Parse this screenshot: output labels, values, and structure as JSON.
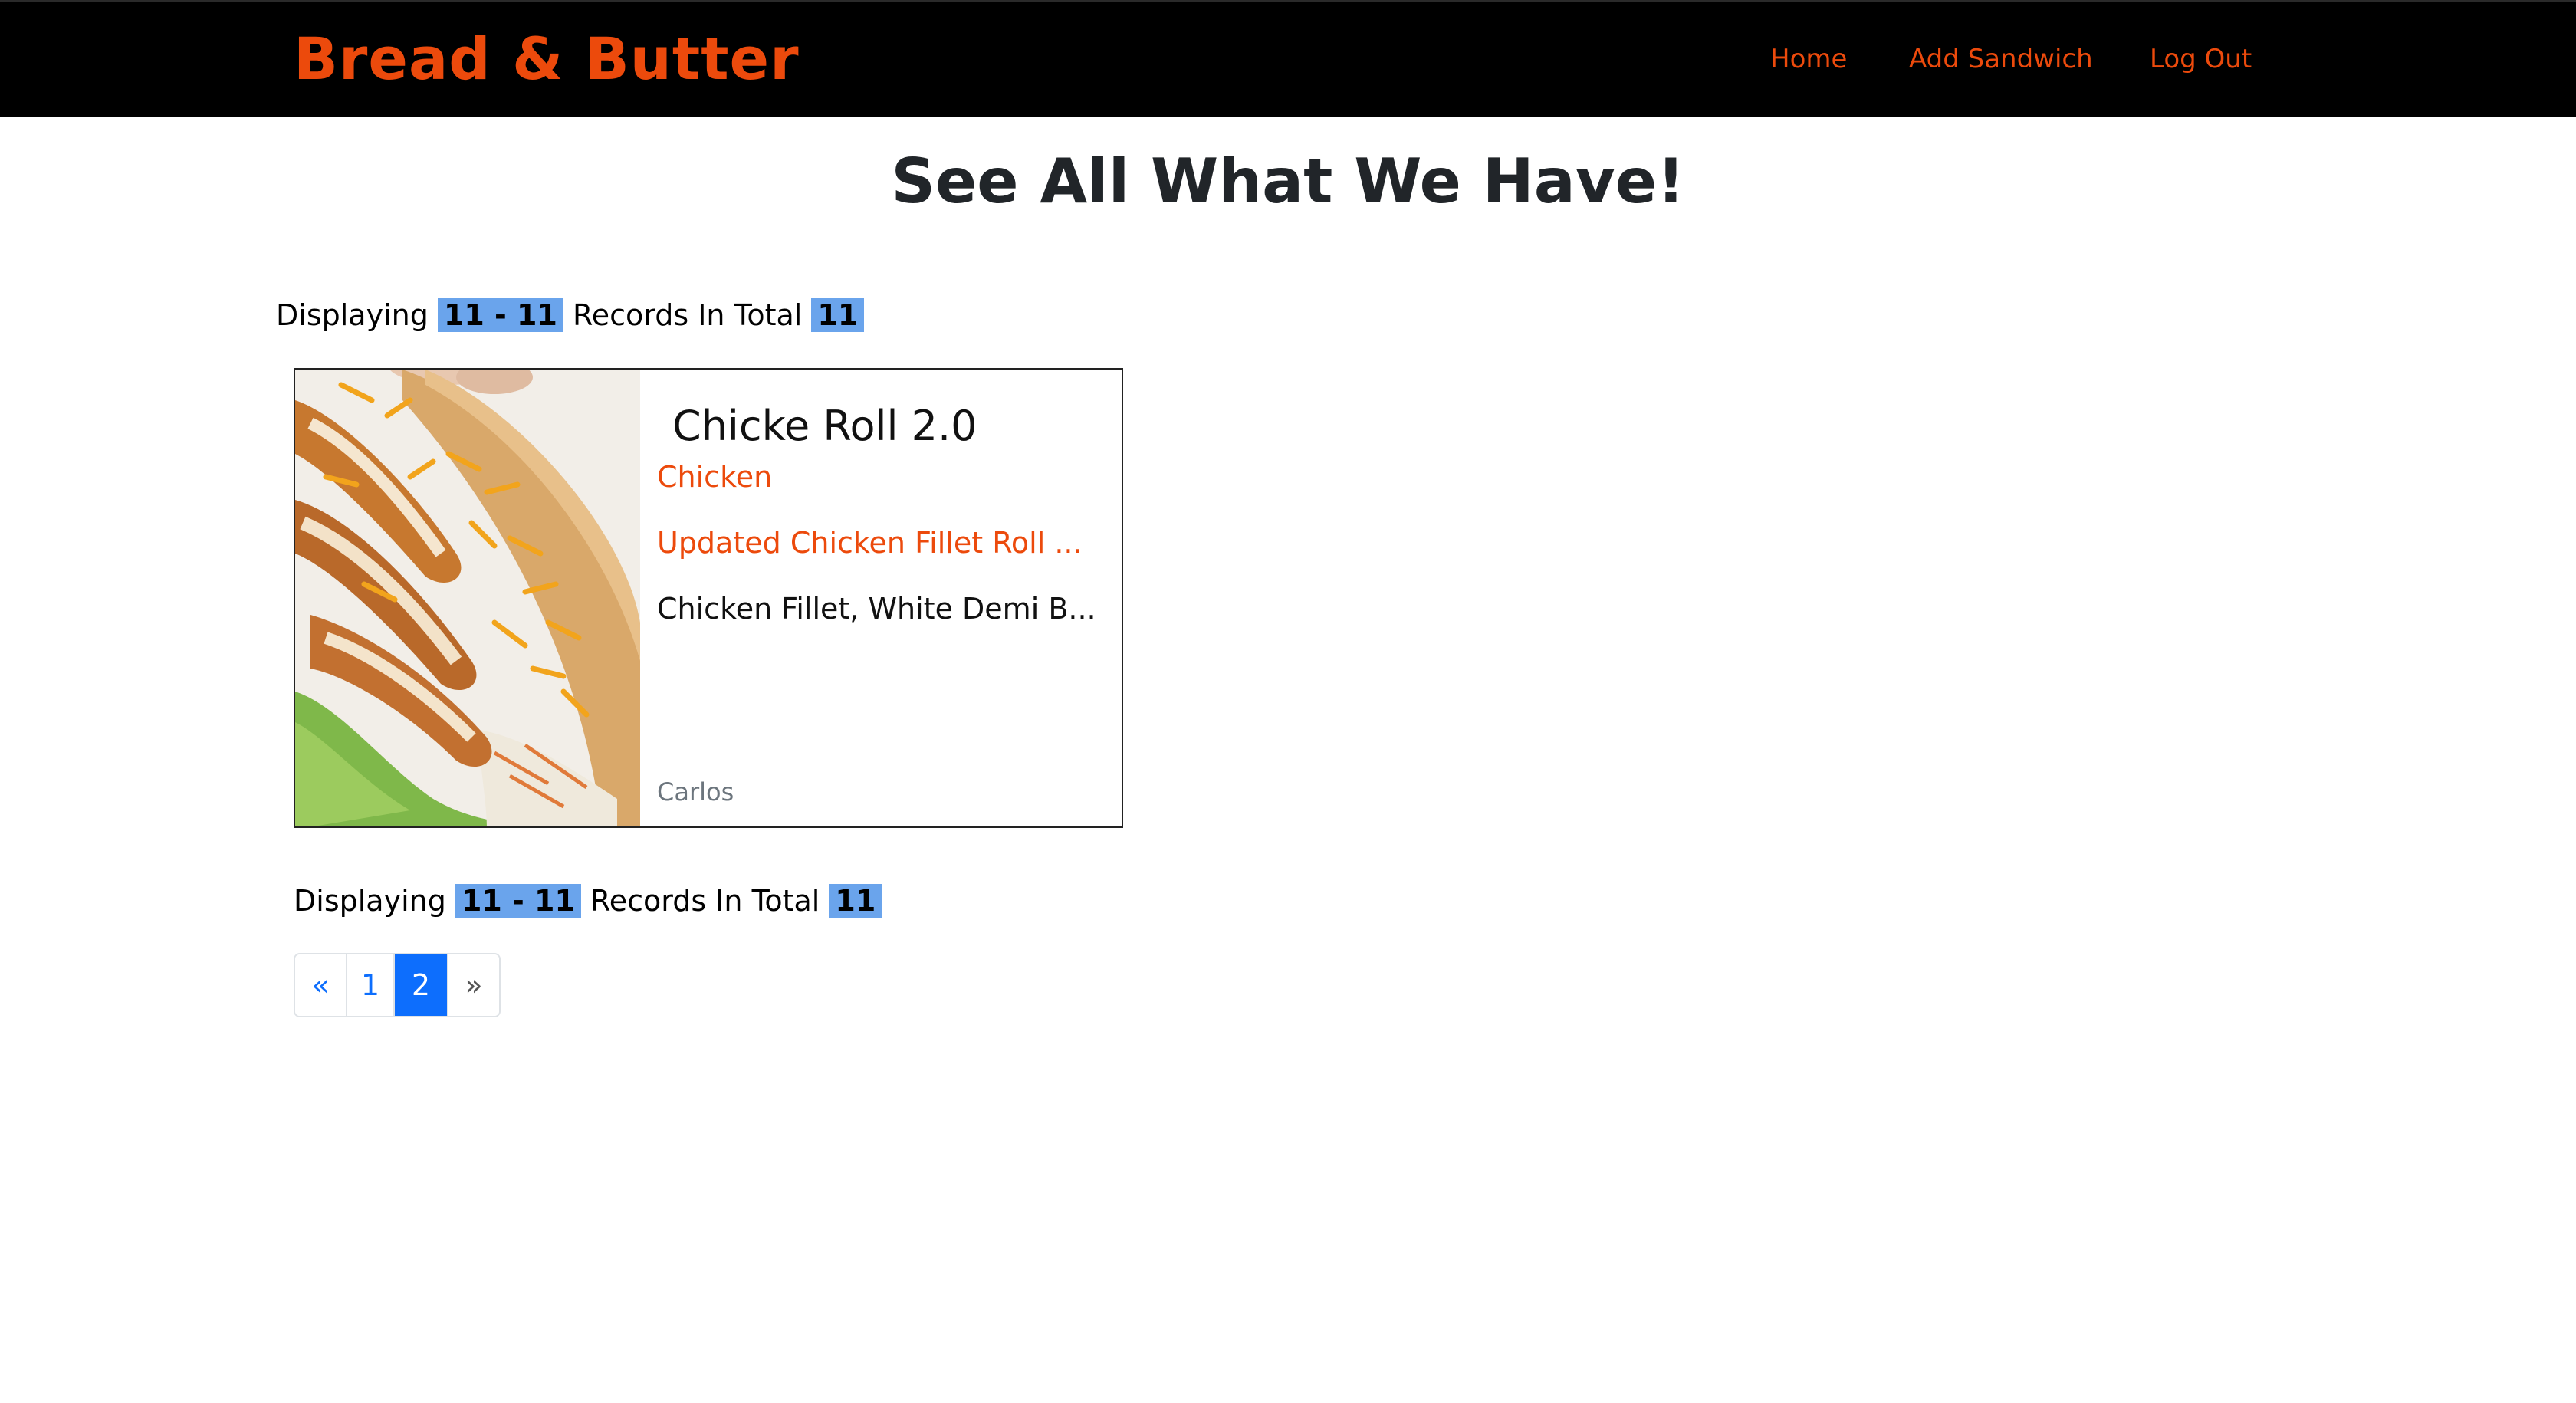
{
  "navbar": {
    "brand": "Bread & Butter",
    "links": {
      "home": "Home",
      "add_sandwich": "Add Sandwich",
      "log_out": "Log Out"
    }
  },
  "main": {
    "title": "See All What We Have!",
    "records_top": {
      "prefix": "Displaying",
      "range": "11 - 11",
      "middle": "Records In Total",
      "total": "11"
    },
    "records_bottom": {
      "prefix": "Displaying",
      "range": "11 - 11",
      "middle": "Records In Total",
      "total": "11"
    },
    "cards": [
      {
        "title": "Chicke Roll 2.0",
        "category": "Chicken",
        "description": "Updated Chicken Fillet Roll ...",
        "ingredients": "Chicken Fillet, White Demi B...",
        "author": "Carlos"
      }
    ],
    "pagination": {
      "prev": "«",
      "pages": [
        "1",
        "2"
      ],
      "current": "2",
      "next": "»"
    }
  },
  "colors": {
    "accent": "#ec4a0c",
    "navbar_bg": "#000000",
    "highlight": "#6aa4ec",
    "pagination_active": "#0d6efd"
  }
}
